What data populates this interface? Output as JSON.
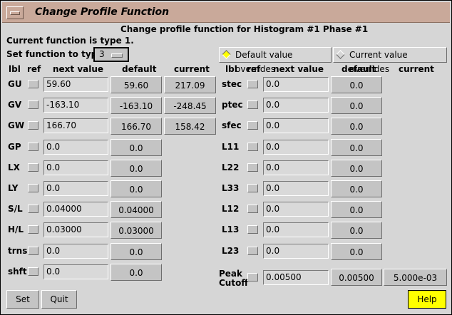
{
  "window": {
    "title": "Change Profile Function"
  },
  "header": {
    "subtitle": "Change profile function for Histogram #1 Phase #1",
    "current_function": "Current function is type 1.",
    "set_type_label": "Set function to type",
    "type_value": "3"
  },
  "overrides": {
    "default_label": "Default value overrides",
    "current_label": "Current value overrides",
    "selected": "default"
  },
  "columns": {
    "lbl": "lbl",
    "ref": "ref",
    "next_value": "next value",
    "default": "default",
    "current": "current"
  },
  "left_rows": [
    {
      "label": "GU",
      "next": "59.60",
      "default": "59.60",
      "current": "217.09"
    },
    {
      "label": "GV",
      "next": "-163.10",
      "default": "-163.10",
      "current": "-248.45"
    },
    {
      "label": "GW",
      "next": "166.70",
      "default": "166.70",
      "current": "158.42"
    },
    {
      "label": "GP",
      "next": "0.0",
      "default": "0.0"
    },
    {
      "label": "LX",
      "next": "0.0",
      "default": "0.0"
    },
    {
      "label": "LY",
      "next": "0.0",
      "default": "0.0"
    },
    {
      "label": "S/L",
      "next": "0.04000",
      "default": "0.04000"
    },
    {
      "label": "H/L",
      "next": "0.03000",
      "default": "0.03000"
    },
    {
      "label": "trns",
      "next": "0.0",
      "default": "0.0"
    },
    {
      "label": "shft",
      "next": "0.0",
      "default": "0.0"
    }
  ],
  "right_rows": [
    {
      "label": "stec",
      "next": "0.0",
      "default": "0.0"
    },
    {
      "label": "ptec",
      "next": "0.0",
      "default": "0.0"
    },
    {
      "label": "sfec",
      "next": "0.0",
      "default": "0.0"
    },
    {
      "label": "L11",
      "next": "0.0",
      "default": "0.0"
    },
    {
      "label": "L22",
      "next": "0.0",
      "default": "0.0"
    },
    {
      "label": "L33",
      "next": "0.0",
      "default": "0.0"
    },
    {
      "label": "L12",
      "next": "0.0",
      "default": "0.0"
    },
    {
      "label": "L13",
      "next": "0.0",
      "default": "0.0"
    },
    {
      "label": "L23",
      "next": "0.0",
      "default": "0.0"
    }
  ],
  "peak": {
    "label_line1": "Peak",
    "label_line2": "Cutoff",
    "next": "0.00500",
    "default": "0.00500",
    "current": "5.000e-03"
  },
  "buttons": {
    "set": "Set",
    "quit": "Quit",
    "help": "Help"
  }
}
